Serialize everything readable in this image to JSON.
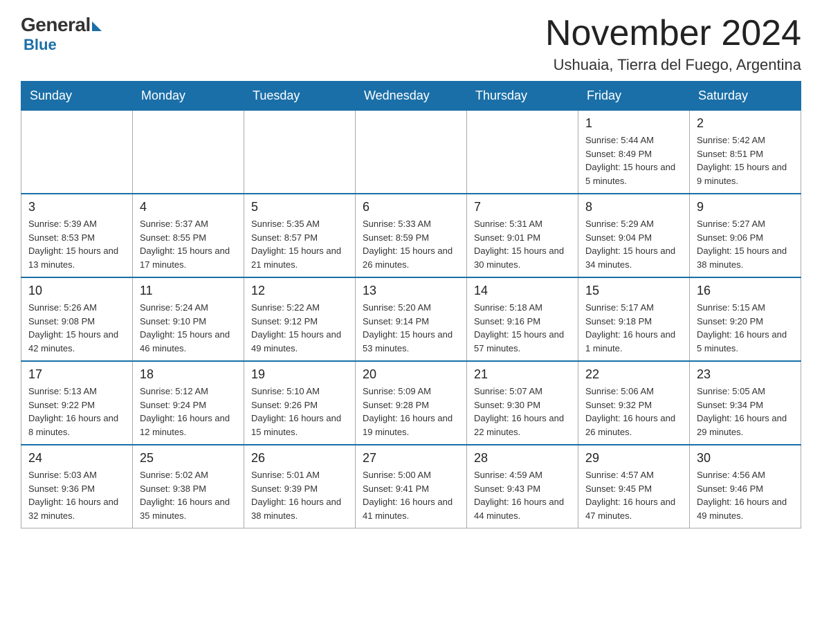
{
  "logo": {
    "general": "General",
    "blue": "Blue"
  },
  "title": "November 2024",
  "subtitle": "Ushuaia, Tierra del Fuego, Argentina",
  "days_of_week": [
    "Sunday",
    "Monday",
    "Tuesday",
    "Wednesday",
    "Thursday",
    "Friday",
    "Saturday"
  ],
  "weeks": [
    [
      {
        "day": "",
        "info": ""
      },
      {
        "day": "",
        "info": ""
      },
      {
        "day": "",
        "info": ""
      },
      {
        "day": "",
        "info": ""
      },
      {
        "day": "",
        "info": ""
      },
      {
        "day": "1",
        "info": "Sunrise: 5:44 AM\nSunset: 8:49 PM\nDaylight: 15 hours and 5 minutes."
      },
      {
        "day": "2",
        "info": "Sunrise: 5:42 AM\nSunset: 8:51 PM\nDaylight: 15 hours and 9 minutes."
      }
    ],
    [
      {
        "day": "3",
        "info": "Sunrise: 5:39 AM\nSunset: 8:53 PM\nDaylight: 15 hours and 13 minutes."
      },
      {
        "day": "4",
        "info": "Sunrise: 5:37 AM\nSunset: 8:55 PM\nDaylight: 15 hours and 17 minutes."
      },
      {
        "day": "5",
        "info": "Sunrise: 5:35 AM\nSunset: 8:57 PM\nDaylight: 15 hours and 21 minutes."
      },
      {
        "day": "6",
        "info": "Sunrise: 5:33 AM\nSunset: 8:59 PM\nDaylight: 15 hours and 26 minutes."
      },
      {
        "day": "7",
        "info": "Sunrise: 5:31 AM\nSunset: 9:01 PM\nDaylight: 15 hours and 30 minutes."
      },
      {
        "day": "8",
        "info": "Sunrise: 5:29 AM\nSunset: 9:04 PM\nDaylight: 15 hours and 34 minutes."
      },
      {
        "day": "9",
        "info": "Sunrise: 5:27 AM\nSunset: 9:06 PM\nDaylight: 15 hours and 38 minutes."
      }
    ],
    [
      {
        "day": "10",
        "info": "Sunrise: 5:26 AM\nSunset: 9:08 PM\nDaylight: 15 hours and 42 minutes."
      },
      {
        "day": "11",
        "info": "Sunrise: 5:24 AM\nSunset: 9:10 PM\nDaylight: 15 hours and 46 minutes."
      },
      {
        "day": "12",
        "info": "Sunrise: 5:22 AM\nSunset: 9:12 PM\nDaylight: 15 hours and 49 minutes."
      },
      {
        "day": "13",
        "info": "Sunrise: 5:20 AM\nSunset: 9:14 PM\nDaylight: 15 hours and 53 minutes."
      },
      {
        "day": "14",
        "info": "Sunrise: 5:18 AM\nSunset: 9:16 PM\nDaylight: 15 hours and 57 minutes."
      },
      {
        "day": "15",
        "info": "Sunrise: 5:17 AM\nSunset: 9:18 PM\nDaylight: 16 hours and 1 minute."
      },
      {
        "day": "16",
        "info": "Sunrise: 5:15 AM\nSunset: 9:20 PM\nDaylight: 16 hours and 5 minutes."
      }
    ],
    [
      {
        "day": "17",
        "info": "Sunrise: 5:13 AM\nSunset: 9:22 PM\nDaylight: 16 hours and 8 minutes."
      },
      {
        "day": "18",
        "info": "Sunrise: 5:12 AM\nSunset: 9:24 PM\nDaylight: 16 hours and 12 minutes."
      },
      {
        "day": "19",
        "info": "Sunrise: 5:10 AM\nSunset: 9:26 PM\nDaylight: 16 hours and 15 minutes."
      },
      {
        "day": "20",
        "info": "Sunrise: 5:09 AM\nSunset: 9:28 PM\nDaylight: 16 hours and 19 minutes."
      },
      {
        "day": "21",
        "info": "Sunrise: 5:07 AM\nSunset: 9:30 PM\nDaylight: 16 hours and 22 minutes."
      },
      {
        "day": "22",
        "info": "Sunrise: 5:06 AM\nSunset: 9:32 PM\nDaylight: 16 hours and 26 minutes."
      },
      {
        "day": "23",
        "info": "Sunrise: 5:05 AM\nSunset: 9:34 PM\nDaylight: 16 hours and 29 minutes."
      }
    ],
    [
      {
        "day": "24",
        "info": "Sunrise: 5:03 AM\nSunset: 9:36 PM\nDaylight: 16 hours and 32 minutes."
      },
      {
        "day": "25",
        "info": "Sunrise: 5:02 AM\nSunset: 9:38 PM\nDaylight: 16 hours and 35 minutes."
      },
      {
        "day": "26",
        "info": "Sunrise: 5:01 AM\nSunset: 9:39 PM\nDaylight: 16 hours and 38 minutes."
      },
      {
        "day": "27",
        "info": "Sunrise: 5:00 AM\nSunset: 9:41 PM\nDaylight: 16 hours and 41 minutes."
      },
      {
        "day": "28",
        "info": "Sunrise: 4:59 AM\nSunset: 9:43 PM\nDaylight: 16 hours and 44 minutes."
      },
      {
        "day": "29",
        "info": "Sunrise: 4:57 AM\nSunset: 9:45 PM\nDaylight: 16 hours and 47 minutes."
      },
      {
        "day": "30",
        "info": "Sunrise: 4:56 AM\nSunset: 9:46 PM\nDaylight: 16 hours and 49 minutes."
      }
    ]
  ]
}
